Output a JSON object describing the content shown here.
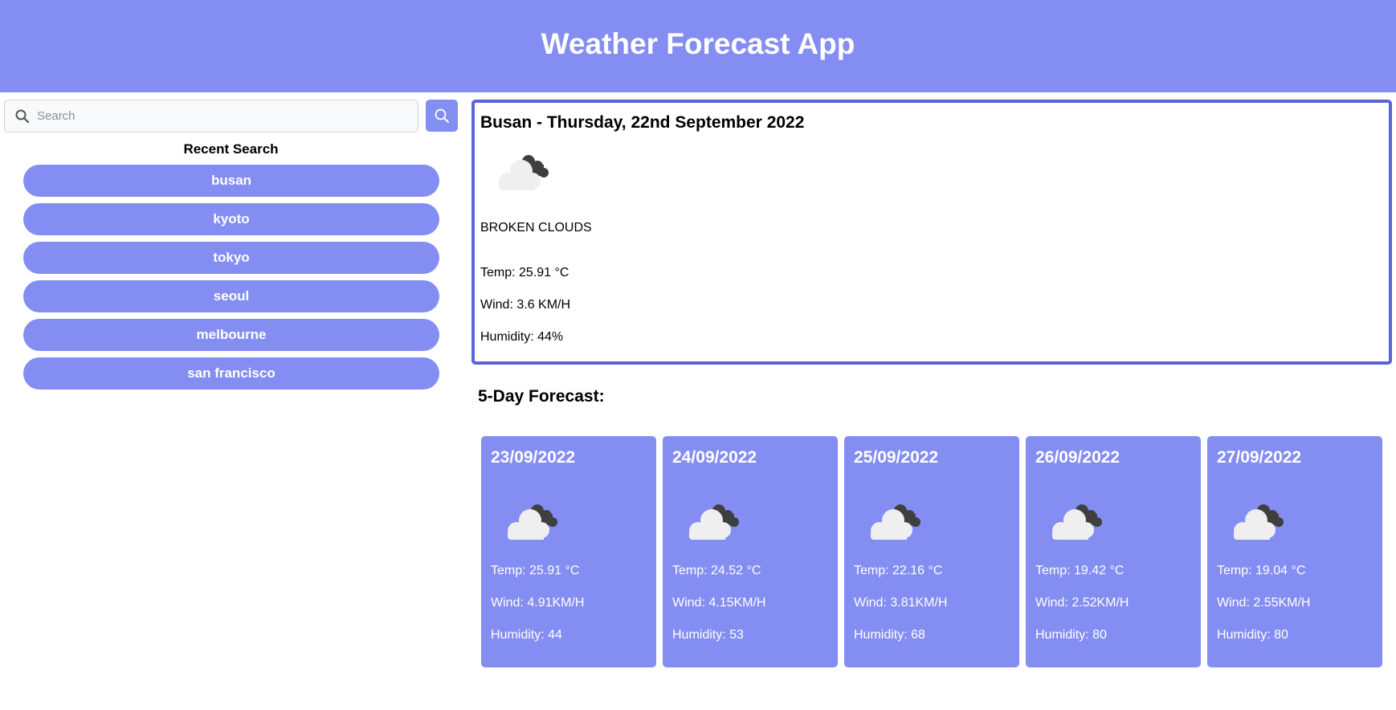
{
  "header": {
    "title": "Weather Forecast App"
  },
  "search": {
    "placeholder": "Search",
    "value": ""
  },
  "recent": {
    "title": "Recent Search",
    "items": [
      "busan",
      "kyoto",
      "tokyo",
      "seoul",
      "melbourne",
      "san francisco"
    ]
  },
  "current": {
    "title": "Busan - Thursday, 22nd September 2022",
    "icon": "broken-clouds-icon",
    "description": "BROKEN CLOUDS",
    "temp": "Temp: 25.91 °C",
    "wind": "Wind: 3.6 KM/H",
    "humidity": "Humidity: 44%"
  },
  "forecast": {
    "title": "5-Day Forecast:",
    "days": [
      {
        "date": "23/09/2022",
        "icon": "broken-clouds-icon",
        "temp": "Temp: 25.91 °C",
        "wind": "Wind: 4.91KM/H",
        "humidity": "Humidity: 44"
      },
      {
        "date": "24/09/2022",
        "icon": "broken-clouds-icon",
        "temp": "Temp: 24.52 °C",
        "wind": "Wind: 4.15KM/H",
        "humidity": "Humidity: 53"
      },
      {
        "date": "25/09/2022",
        "icon": "broken-clouds-icon",
        "temp": "Temp: 22.16 °C",
        "wind": "Wind: 3.81KM/H",
        "humidity": "Humidity: 68"
      },
      {
        "date": "26/09/2022",
        "icon": "broken-clouds-icon",
        "temp": "Temp: 19.42 °C",
        "wind": "Wind: 2.52KM/H",
        "humidity": "Humidity: 80"
      },
      {
        "date": "27/09/2022",
        "icon": "broken-clouds-icon",
        "temp": "Temp: 19.04 °C",
        "wind": "Wind: 2.55KM/H",
        "humidity": "Humidity: 80"
      }
    ]
  },
  "colors": {
    "accent": "#848ef2",
    "border": "#5b63d9"
  }
}
